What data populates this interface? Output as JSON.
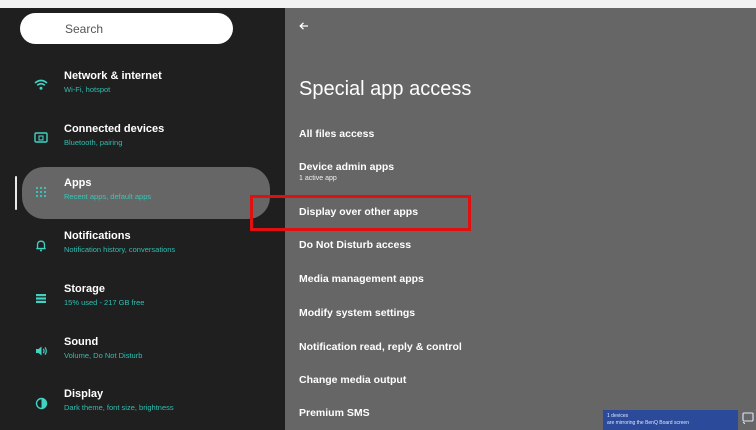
{
  "search": {
    "placeholder": "Search"
  },
  "sidebar": {
    "items": [
      {
        "title": "Network & internet",
        "sub": "Wi-Fi, hotspot",
        "icon": "wifi-icon"
      },
      {
        "title": "Connected devices",
        "sub": "Bluetooth, pairing",
        "icon": "devices-icon"
      },
      {
        "title": "Apps",
        "sub": "Recent apps, default apps",
        "icon": "apps-grid-icon",
        "selected": true
      },
      {
        "title": "Notifications",
        "sub": "Notification history, conversations",
        "icon": "bell-icon"
      },
      {
        "title": "Storage",
        "sub": "15% used - 217 GB free",
        "icon": "storage-icon"
      },
      {
        "title": "Sound",
        "sub": "Volume, Do Not Disturb",
        "icon": "volume-icon"
      },
      {
        "title": "Display",
        "sub": "Dark theme, font size, brightness",
        "icon": "display-icon"
      }
    ]
  },
  "main": {
    "back_icon": "back-arrow-icon",
    "title": "Special app access",
    "items": [
      {
        "title": "All files access"
      },
      {
        "title": "Device admin apps",
        "sub": "1 active app"
      },
      {
        "title": "Display over other apps"
      },
      {
        "title": "Do Not Disturb access"
      },
      {
        "title": "Media management apps"
      },
      {
        "title": "Modify system settings"
      },
      {
        "title": "Notification read, reply & control"
      },
      {
        "title": "Change media output"
      },
      {
        "title": "Premium SMS"
      }
    ]
  },
  "toast": {
    "line1": "1 devices",
    "line2": "are mirroring the BenQ Board screen"
  },
  "colors": {
    "sidebar_bg": "#1f1f1f",
    "main_bg": "#666666",
    "accent": "#3fd3c3",
    "highlight": "#e01010"
  }
}
